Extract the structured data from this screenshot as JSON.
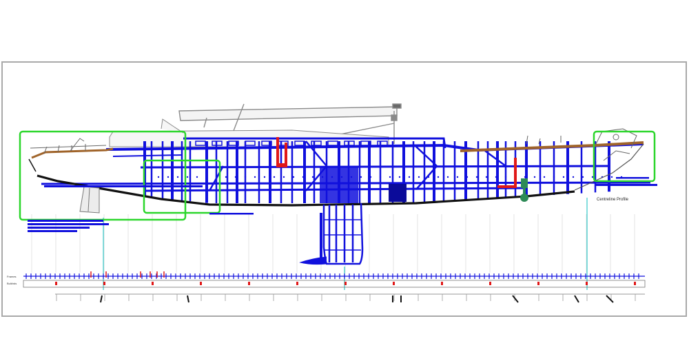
{
  "drawing": {
    "view_label": "Centreline Profile",
    "ruler_top_label": "Frames",
    "ruler_bottom_label": "Bulkhds",
    "colors": {
      "structure": "#1010dd",
      "structure_dark": "#0000aa",
      "highlight_box": "#2bd62b",
      "deck": "#a0642a",
      "bulkhead_red": "#e01818",
      "hull_line": "#111111",
      "rig": "#8a8a8a",
      "machinery": "#2e8b57",
      "cyan_line": "#33c8c8",
      "frame_border": "#a9a9a9"
    }
  }
}
